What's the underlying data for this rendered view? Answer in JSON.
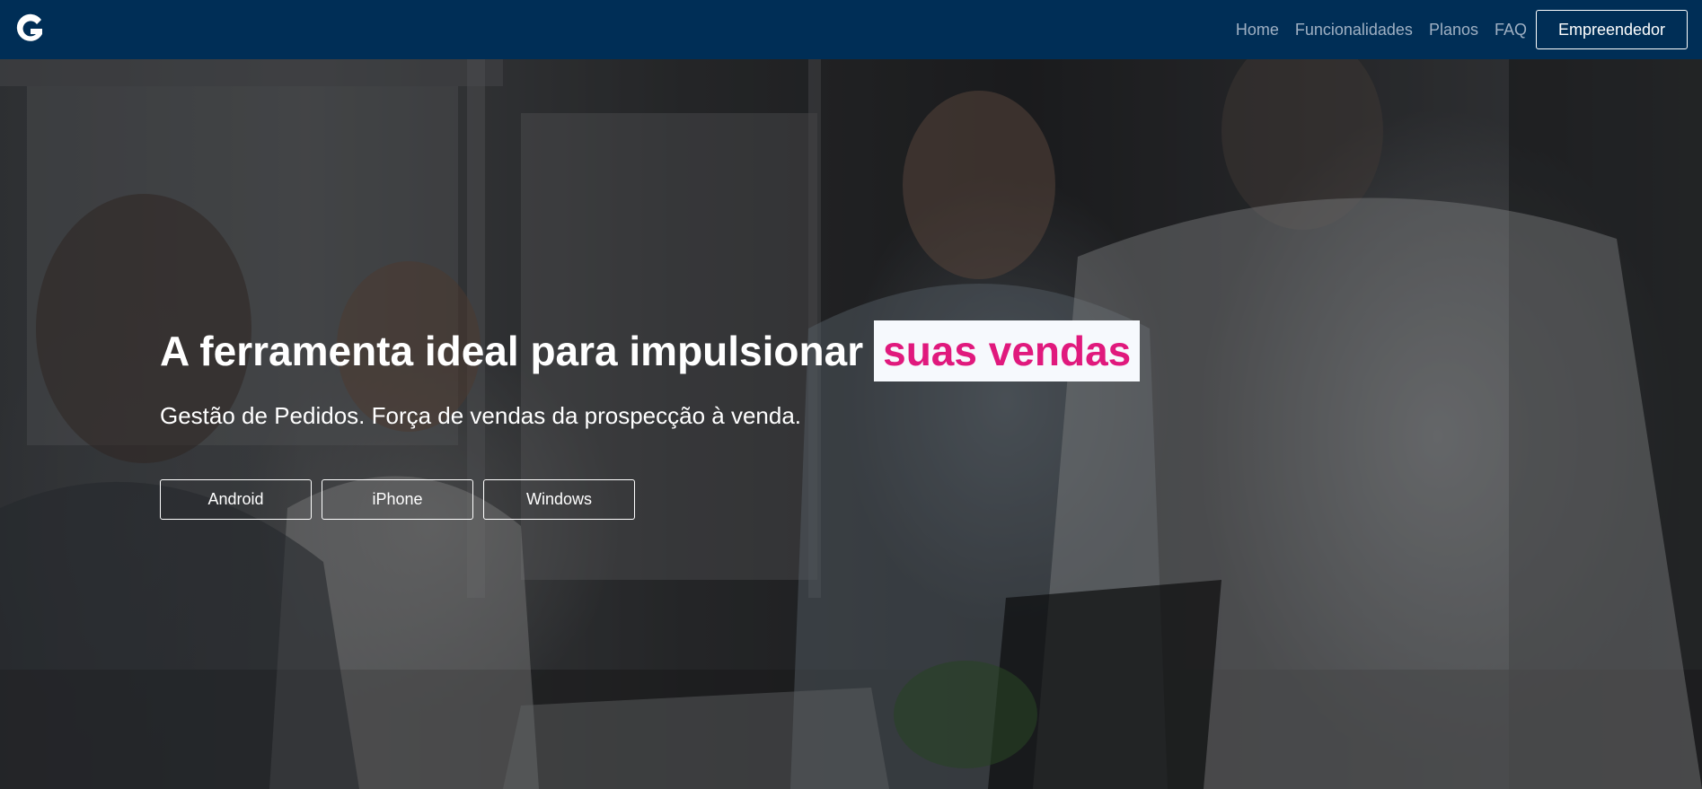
{
  "brand": {
    "logo_letter": "G"
  },
  "nav": {
    "links": [
      "Home",
      "Funcionalidades",
      "Planos",
      "FAQ"
    ],
    "cta_label": "Empreendedor"
  },
  "hero": {
    "title": "A ferramenta ideal para impulsionar",
    "title_highlight": "suas vendas",
    "subtitle": "Gestão de Pedidos. Força de vendas da prospecção à venda.",
    "buttons": [
      "Android",
      "iPhone",
      "Windows"
    ]
  },
  "colors": {
    "navbar": "#002e56",
    "highlight_text": "#e0197d",
    "highlight_bg": "#f6f9fd"
  }
}
